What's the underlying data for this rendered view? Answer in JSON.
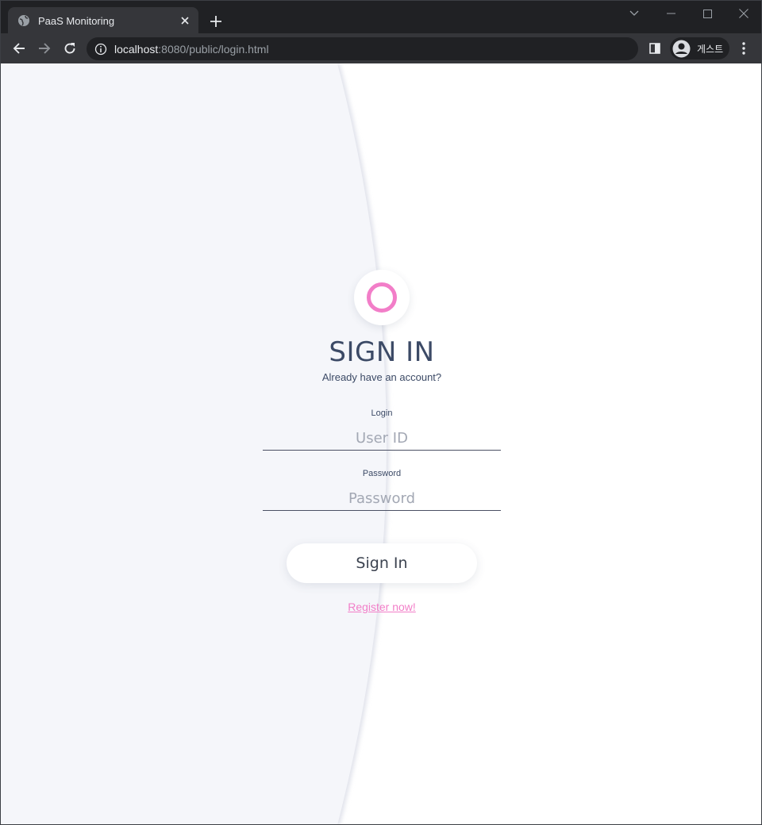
{
  "browser": {
    "tab_title": "PaaS Monitoring",
    "url_host": "localhost",
    "url_path": ":8080/public/login.html",
    "profile_name": "게스트"
  },
  "page": {
    "heading": "SIGN IN",
    "subheading": "Already have an account?",
    "login_label": "Login",
    "login_placeholder": "User ID",
    "password_label": "Password",
    "password_placeholder": "Password",
    "signin_button": "Sign In",
    "register_link": "Register now!"
  },
  "colors": {
    "accent_pink": "#f27ec8",
    "text_navy": "#3c4a66",
    "left_panel_bg": "#f5f6fa"
  }
}
